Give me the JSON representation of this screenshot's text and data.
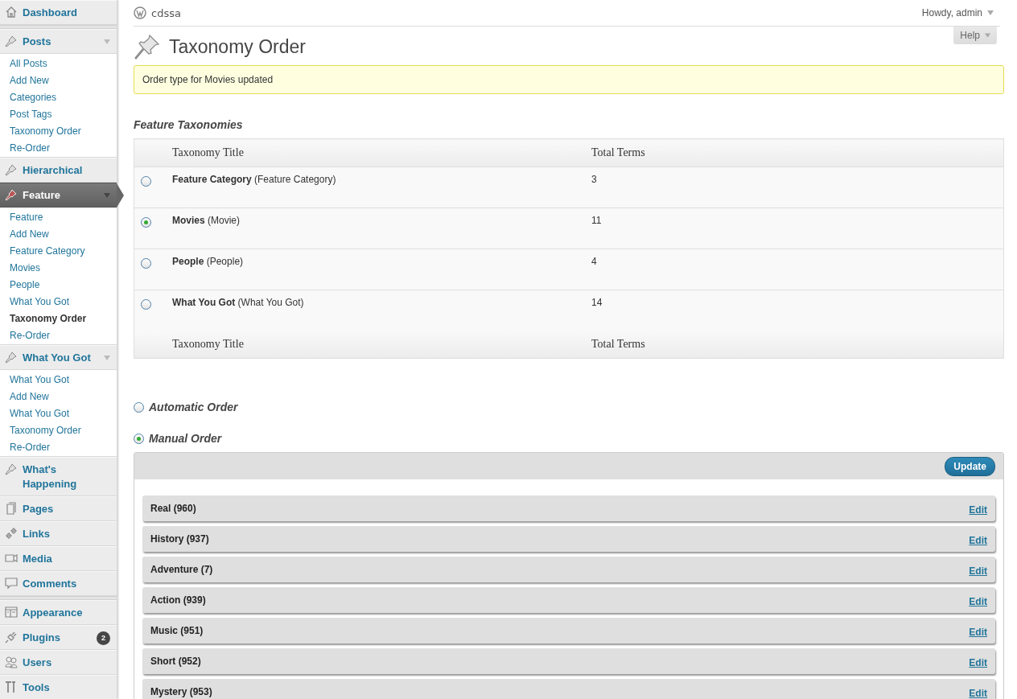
{
  "sidebar": {
    "sections": [
      [
        {
          "label": "Dashboard",
          "current": false,
          "expanded": false
        }
      ],
      [
        {
          "label": "Posts",
          "current": false,
          "expanded": true,
          "children": [
            {
              "label": "All Posts",
              "selected": false
            },
            {
              "label": "Add New",
              "selected": false
            },
            {
              "label": "Categories",
              "selected": false
            },
            {
              "label": "Post Tags",
              "selected": false
            },
            {
              "label": "Taxonomy Order",
              "selected": false
            },
            {
              "label": "Re-Order",
              "selected": false
            }
          ]
        },
        {
          "label": "Hierarchical",
          "current": false,
          "expanded": false
        },
        {
          "label": "Feature",
          "current": true,
          "expanded": true,
          "children": [
            {
              "label": "Feature",
              "selected": false
            },
            {
              "label": "Add New",
              "selected": false
            },
            {
              "label": "Feature Category",
              "selected": false
            },
            {
              "label": "Movies",
              "selected": false
            },
            {
              "label": "People",
              "selected": false
            },
            {
              "label": "What You Got",
              "selected": false
            },
            {
              "label": "Taxonomy Order",
              "selected": true
            },
            {
              "label": "Re-Order",
              "selected": false
            }
          ]
        },
        {
          "label": "What You Got",
          "current": false,
          "expanded": true,
          "children": [
            {
              "label": "What You Got",
              "selected": false
            },
            {
              "label": "Add New",
              "selected": false
            },
            {
              "label": "What You Got",
              "selected": false
            },
            {
              "label": "Taxonomy Order",
              "selected": false
            },
            {
              "label": "Re-Order",
              "selected": false
            }
          ]
        },
        {
          "label": "What's Happening",
          "current": false,
          "expanded": false
        },
        {
          "label": "Pages",
          "current": false,
          "expanded": false
        },
        {
          "label": "Links",
          "current": false,
          "expanded": false
        },
        {
          "label": "Media",
          "current": false,
          "expanded": false
        },
        {
          "label": "Comments",
          "current": false,
          "expanded": false
        }
      ],
      [
        {
          "label": "Appearance",
          "current": false,
          "expanded": false
        },
        {
          "label": "Plugins",
          "current": false,
          "expanded": false,
          "badge": "2"
        },
        {
          "label": "Users",
          "current": false,
          "expanded": false
        },
        {
          "label": "Tools",
          "current": false,
          "expanded": false
        }
      ]
    ]
  },
  "header": {
    "site_name": "cdssa",
    "user_menu": "Howdy, admin",
    "help": "Help"
  },
  "page_title": "Taxonomy Order",
  "notice": "Order type for Movies updated",
  "taxonomies": {
    "heading": "Feature Taxonomies",
    "columns": [
      "Taxonomy Title",
      "Total Terms"
    ],
    "rows": [
      {
        "title": "**Feature Category** (Feature Category)",
        "total": "3",
        "selected": false
      },
      {
        "title": "**Movies** (Movie)",
        "total": "11",
        "selected": true
      },
      {
        "title": "**People** (People)",
        "total": "4",
        "selected": false
      },
      {
        "title": "**What You Got** (What You Got)",
        "total": "14",
        "selected": false
      }
    ],
    "footer_columns": [
      "Taxonomy Title",
      "Total Terms"
    ]
  },
  "order_types": [
    {
      "label": "Automatic Order",
      "selected": false
    },
    {
      "label": "Manual Order",
      "selected": true
    }
  ],
  "terms_box": {
    "button": "Update",
    "terms": [
      {
        "label": "Real (960)",
        "action": "Edit"
      },
      {
        "label": "History (937)",
        "action": "Edit"
      },
      {
        "label": "Adventure (7)",
        "action": "Edit"
      },
      {
        "label": "Action (939)",
        "action": "Edit"
      },
      {
        "label": "Music (951)",
        "action": "Edit"
      },
      {
        "label": "Short (952)",
        "action": "Edit"
      },
      {
        "label": "Mystery (953)",
        "action": "Edit"
      }
    ]
  }
}
